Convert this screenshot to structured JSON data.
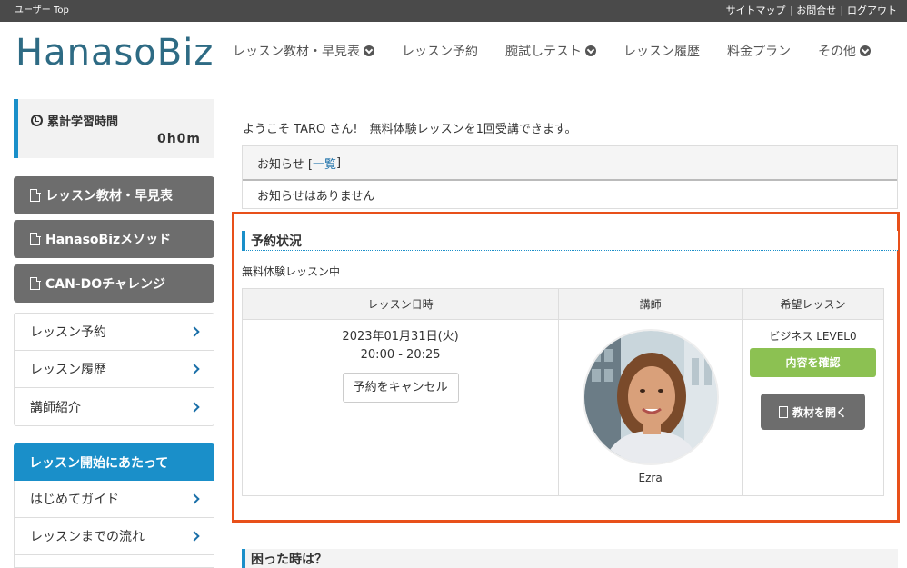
{
  "topbar": {
    "crumb": "ユーザー Top",
    "links": [
      "サイトマップ",
      "お問合せ",
      "ログアウト"
    ]
  },
  "logo": "HanasoBiz",
  "gnav": [
    {
      "label": "レッスン教材・早見表",
      "dropdown": true
    },
    {
      "label": "レッスン予約",
      "dropdown": false
    },
    {
      "label": "腕試しテスト",
      "dropdown": true
    },
    {
      "label": "レッスン履歴",
      "dropdown": false
    },
    {
      "label": "料金プラン",
      "dropdown": false
    },
    {
      "label": "その他",
      "dropdown": true
    }
  ],
  "sidebar": {
    "study_label": "累計学習時間",
    "study_value": "0h0m",
    "buttons": [
      "レッスン教材・早見表",
      "HanasoBizメソッド",
      "CAN-DOチャレンジ"
    ],
    "links": [
      "レッスン予約",
      "レッスン履歴",
      "講師紹介"
    ],
    "section_head": "レッスン開始にあたって",
    "section_links": [
      "はじめてガイド",
      "レッスンまでの流れ"
    ]
  },
  "main": {
    "welcome": "ようこそ TARO さん!　無料体験レッスンを1回受講できます。",
    "notice_head": "お知らせ [",
    "notice_link": "一覧",
    "notice_head_end": "]",
    "notice_body": "お知らせはありません",
    "reservation_title": "予約状況",
    "trial_label": "無料体験レッスン中",
    "table_headers": [
      "レッスン日時",
      "講師",
      "希望レッスン"
    ],
    "date": "2023年01月31日(火)",
    "time": "20:00 - 20:25",
    "cancel_label": "予約をキャンセル",
    "teacher_name": "Ezra",
    "lesson_level": "ビジネス LEVEL0",
    "confirm_label": "内容を確認",
    "open_label": "教材を開く",
    "help_title": "困った時は？"
  },
  "colors": {
    "accent": "#1a8fc9",
    "highlight": "#e8501a",
    "confirm": "#8cc152",
    "dark_button": "#6d6d6d"
  }
}
